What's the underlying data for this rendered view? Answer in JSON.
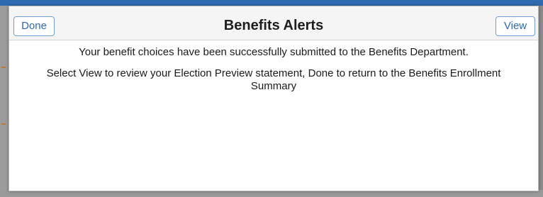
{
  "dialog": {
    "title": "Benefits Alerts",
    "done_label": "Done",
    "view_label": "View",
    "messages": [
      "Your benefit choices have been successfully submitted to the Benefits Department.",
      "Select View to review your Election Preview statement, Done to return to the Benefits Enrollment Summary"
    ]
  },
  "colors": {
    "accent": "#2d6ab1",
    "button_border": "#6d9fd3",
    "header_bg": "#f5f5f5",
    "overlay": "#8a8a8a",
    "top_strip": "#2f6bb0"
  }
}
